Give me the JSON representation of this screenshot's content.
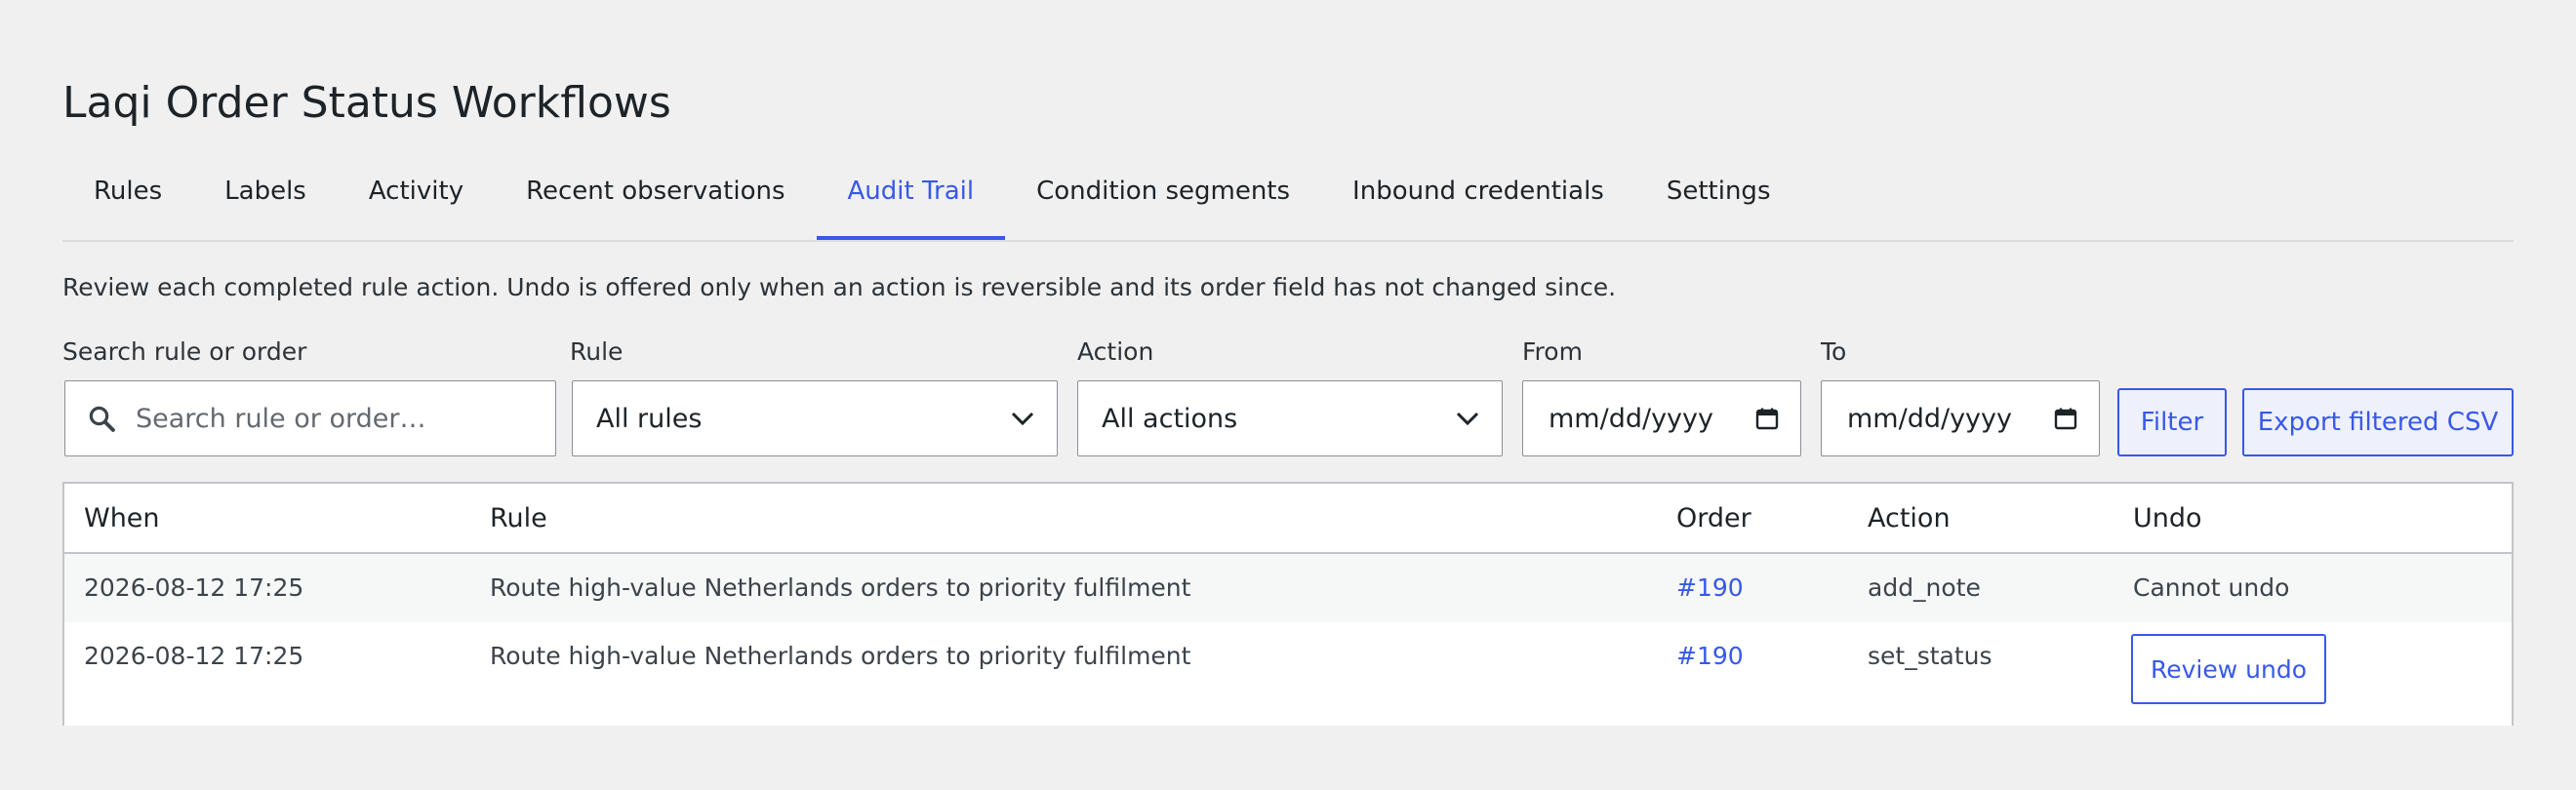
{
  "page": {
    "title": "Laqi Order Status Workflows"
  },
  "tabs": [
    {
      "label": "Rules",
      "active": false
    },
    {
      "label": "Labels",
      "active": false
    },
    {
      "label": "Activity",
      "active": false
    },
    {
      "label": "Recent observations",
      "active": false
    },
    {
      "label": "Audit Trail",
      "active": true
    },
    {
      "label": "Condition segments",
      "active": false
    },
    {
      "label": "Inbound credentials",
      "active": false
    },
    {
      "label": "Settings",
      "active": false
    }
  ],
  "intro": "Review each completed rule action. Undo is offered only when an action is reversible and its order field has not changed since.",
  "filters": {
    "search": {
      "label": "Search rule or order",
      "placeholder": "Search rule or order…",
      "icon": "search-icon"
    },
    "rule": {
      "label": "Rule",
      "value": "All rules"
    },
    "action": {
      "label": "Action",
      "value": "All actions"
    },
    "from": {
      "label": "From",
      "value": "mm/dd/yyyy"
    },
    "to": {
      "label": "To",
      "value": "mm/dd/yyyy"
    },
    "filter_label": "Filter",
    "export_label": "Export filtered CSV"
  },
  "table": {
    "headers": {
      "when": "When",
      "rule": "Rule",
      "order": "Order",
      "action": "Action",
      "undo": "Undo"
    },
    "rows": [
      {
        "when": "2026-08-12 17:25",
        "rule": "Route high-value Netherlands orders to priority fulfilment",
        "order": "#190",
        "action": "add_note",
        "undo": "Cannot undo"
      },
      {
        "when": "2026-08-12 17:25",
        "rule": "Route high-value Netherlands orders to priority fulfilment",
        "order": "#190",
        "action": "set_status",
        "undo": "Review undo"
      }
    ]
  },
  "colors": {
    "accent": "#3858e9",
    "background": "#f0f0f1",
    "border": "#c3c4c7"
  }
}
